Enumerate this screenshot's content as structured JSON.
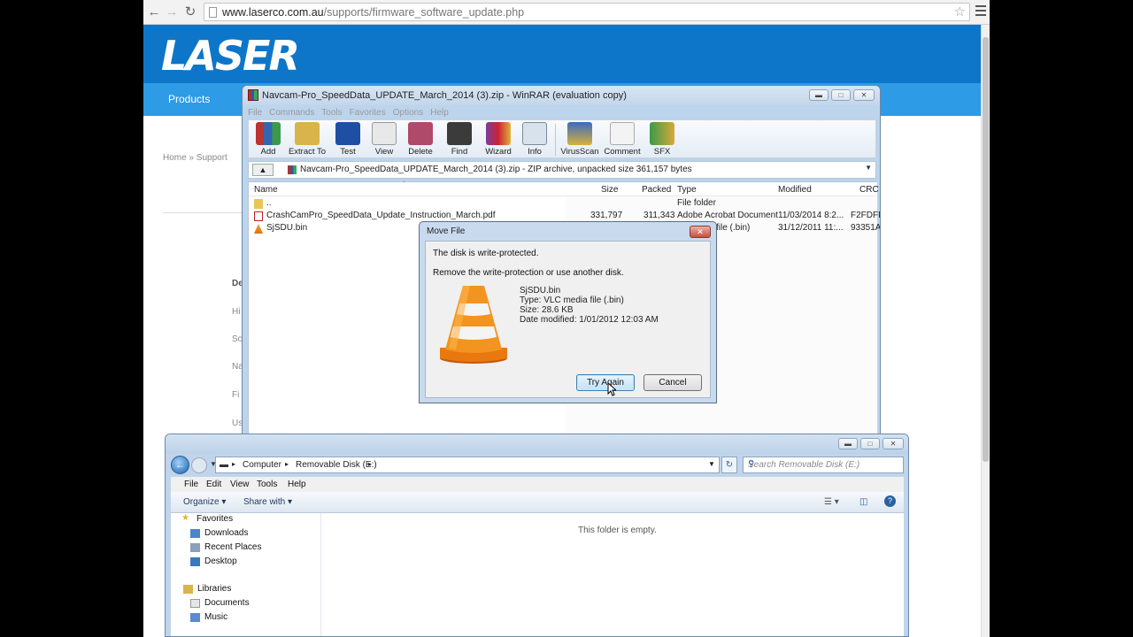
{
  "browser": {
    "url_domain": "www.laserco.com.au",
    "url_path": "/supports/firmware_software_update.php"
  },
  "site": {
    "logo_text": "LASER",
    "nav_products": "Products",
    "breadcrumb": "Home » Support",
    "side_labels": [
      "De",
      "Hi",
      "So",
      "Na",
      "Fi",
      "Us"
    ],
    "brand_color": "#0e76c9"
  },
  "winrar": {
    "title": "Navcam-Pro_SpeedData_UPDATE_March_2014 (3).zip - WinRAR (evaluation copy)",
    "menu": [
      "File",
      "Commands",
      "Tools",
      "Favorites",
      "Options",
      "Help"
    ],
    "toolbar": [
      "Add",
      "Extract To",
      "Test",
      "View",
      "Delete",
      "Find",
      "Wizard",
      "Info",
      "VirusScan",
      "Comment",
      "SFX"
    ],
    "address": "Navcam-Pro_SpeedData_UPDATE_March_2014 (3).zip - ZIP archive, unpacked size 361,157 bytes",
    "columns": [
      "Name",
      "Size",
      "Packed",
      "Type",
      "Modified",
      "CRC"
    ],
    "rows": [
      {
        "name": "..",
        "size": "",
        "packed": "",
        "type": "File folder",
        "modified": "",
        "crc": ""
      },
      {
        "name": "CrashCamPro_SpeedData_Update_Instruction_March.pdf",
        "size": "331,797",
        "packed": "311,343",
        "type": "Adobe Acrobat Document",
        "modified": "11/03/2014 8:2...",
        "crc": "F2FDFF"
      },
      {
        "name": "SjSDU.bin",
        "size": "",
        "packed": "",
        "type": "file (.bin)",
        "modified": "31/12/2011 11:...",
        "crc": "93351A"
      }
    ]
  },
  "dialog": {
    "title": "Move File",
    "message1": "The disk is write-protected.",
    "message2": "Remove the write-protection or use another disk.",
    "file_name": "SjSDU.bin",
    "file_type": "Type: VLC media file (.bin)",
    "file_size": "Size: 28.6 KB",
    "file_modified": "Date modified: 1/01/2012 12:03 AM",
    "try_again": "Try Again",
    "cancel": "Cancel"
  },
  "explorer": {
    "path": [
      "Computer",
      "Removable Disk (E:)"
    ],
    "search_placeholder": "Search Removable Disk (E:)",
    "menu": [
      "File",
      "Edit",
      "View",
      "Tools",
      "Help"
    ],
    "commands": [
      "Organize",
      "Share with"
    ],
    "favorites_label": "Favorites",
    "favorites": [
      "Downloads",
      "Recent Places",
      "Desktop"
    ],
    "libraries_label": "Libraries",
    "libraries": [
      "Documents",
      "Music"
    ],
    "empty_text": "This folder is empty."
  }
}
